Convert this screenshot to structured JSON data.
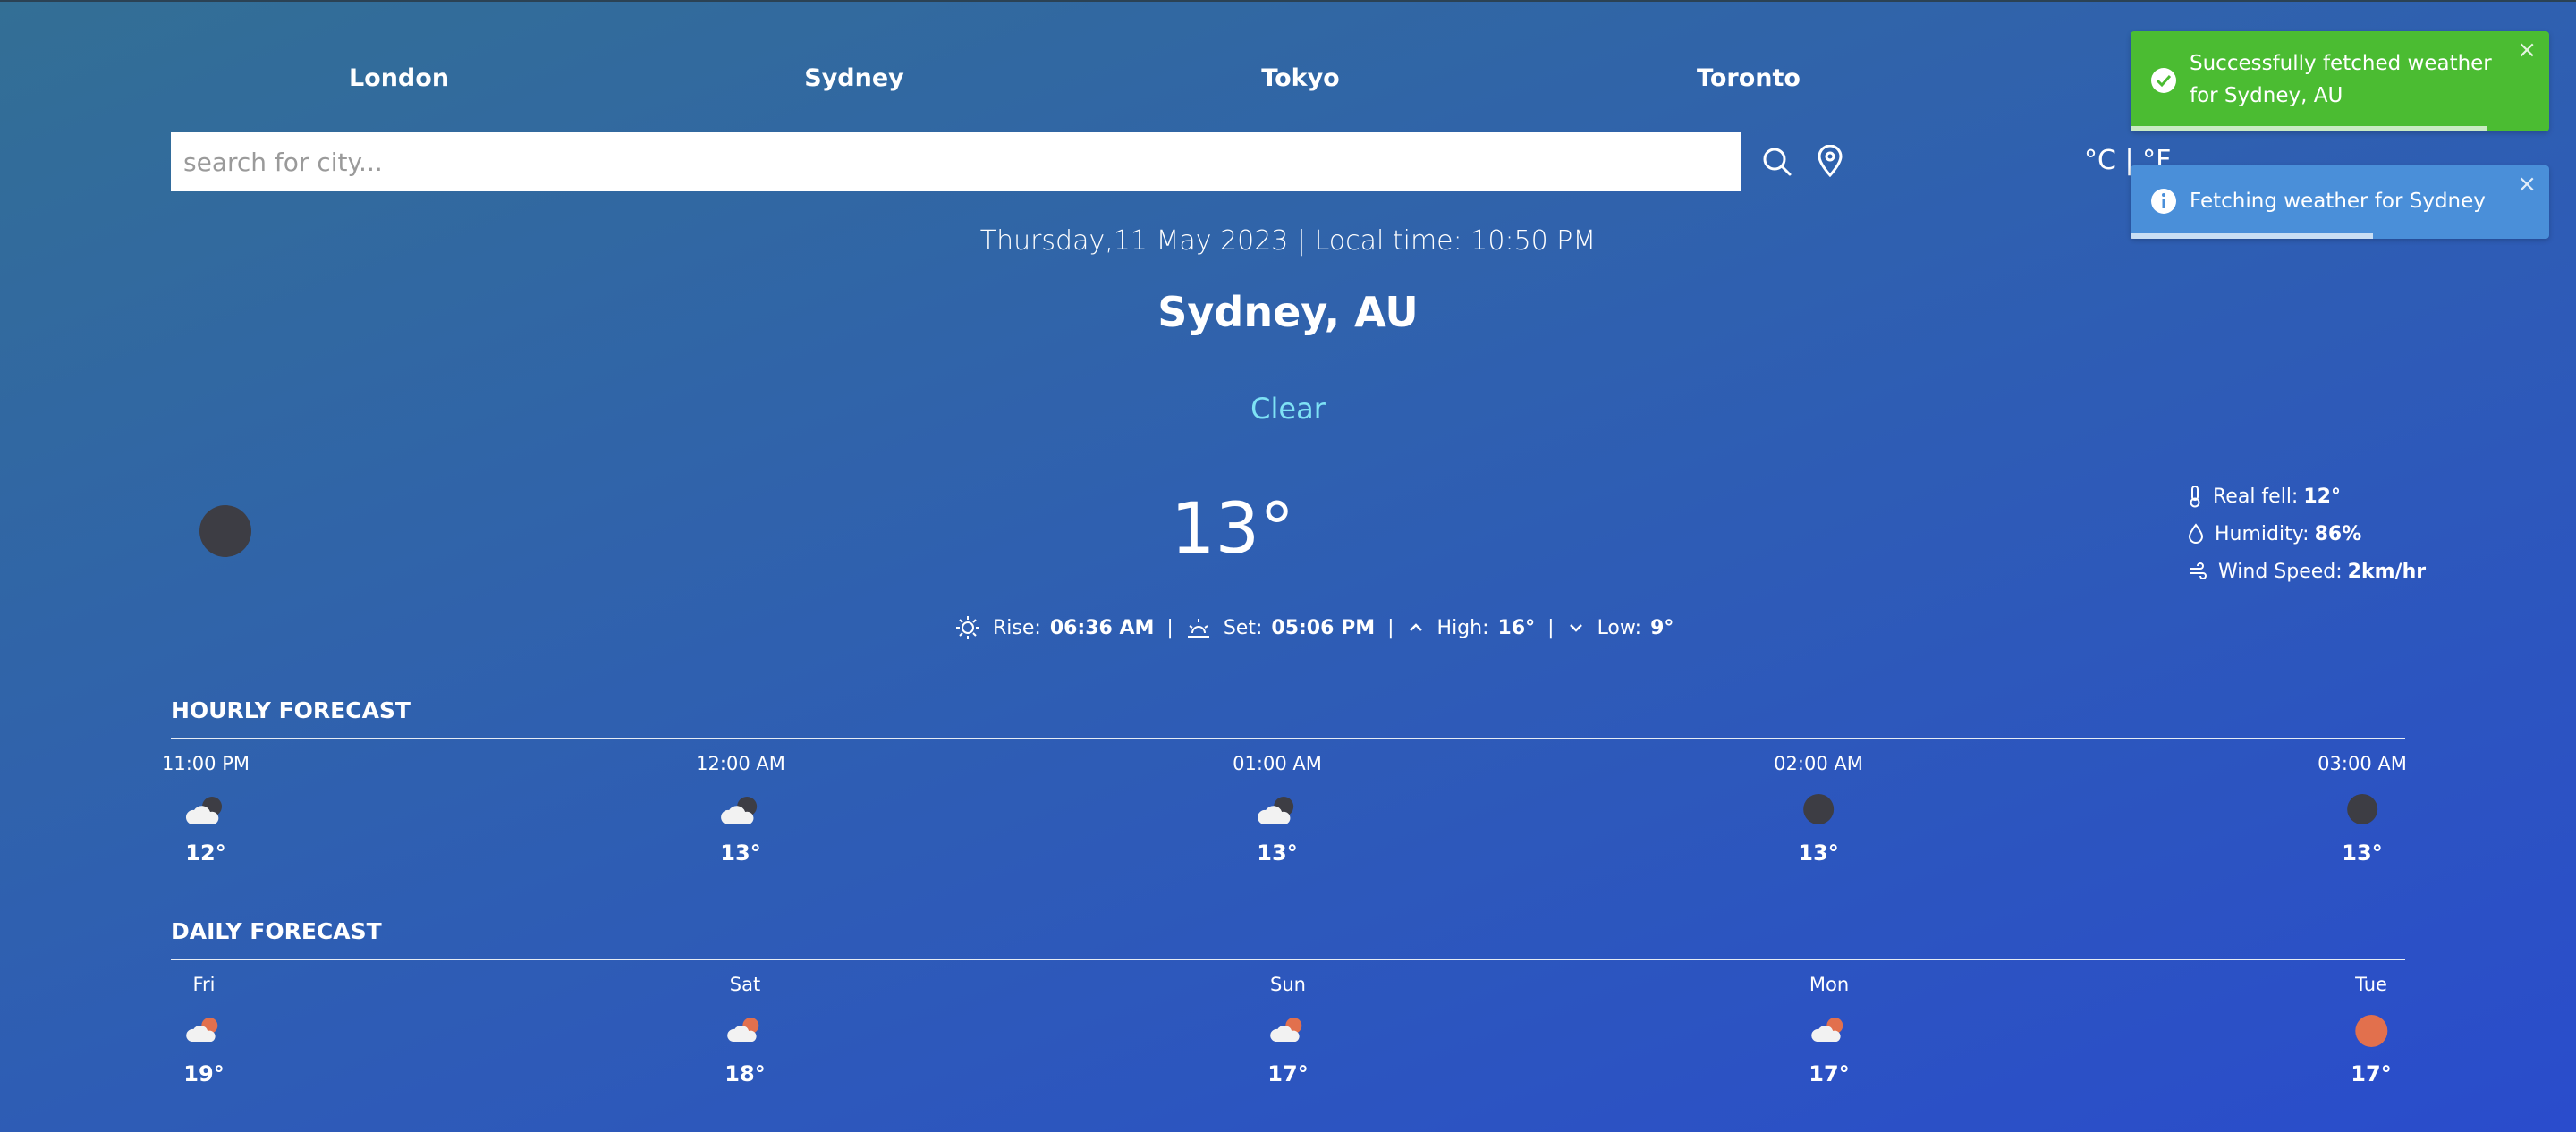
{
  "nav": {
    "cities": [
      "London",
      "Sydney",
      "Tokyo",
      "Toronto"
    ]
  },
  "search": {
    "placeholder": "search for city..."
  },
  "units": {
    "label": "°C | °F"
  },
  "current": {
    "date_line": "Thursday,11 May 2023 | Local time: 10:50 PM",
    "location": "Sydney, AU",
    "condition": "Clear",
    "temperature": "13°",
    "details": [
      {
        "label": "Real fell:",
        "value": "12°",
        "icon": "thermometer-icon"
      },
      {
        "label": "Humidity:",
        "value": "86%",
        "icon": "droplet-icon"
      },
      {
        "label": "Wind Speed:",
        "value": "2km/hr",
        "icon": "wind-icon"
      }
    ],
    "rise_label": "Rise:",
    "rise": "06:36 AM",
    "set_label": "Set:",
    "set": "05:06 PM",
    "high_label": "High:",
    "high": "16°",
    "low_label": "Low:",
    "low": "9°",
    "separator": "|"
  },
  "hourly": {
    "title": "HOURLY FORECAST",
    "items": [
      {
        "time": "11:00 PM",
        "temp": "12°",
        "icon": "cloudy-night-icon"
      },
      {
        "time": "12:00 AM",
        "temp": "13°",
        "icon": "cloudy-night-icon"
      },
      {
        "time": "01:00 AM",
        "temp": "13°",
        "icon": "cloudy-night-icon"
      },
      {
        "time": "02:00 AM",
        "temp": "13°",
        "icon": "clear-night-icon"
      },
      {
        "time": "03:00 AM",
        "temp": "13°",
        "icon": "clear-night-icon"
      }
    ]
  },
  "daily": {
    "title": "DAILY FORECAST",
    "items": [
      {
        "day": "Fri",
        "temp": "19°",
        "icon": "partly-cloudy-icon"
      },
      {
        "day": "Sat",
        "temp": "18°",
        "icon": "partly-cloudy-icon"
      },
      {
        "day": "Sun",
        "temp": "17°",
        "icon": "partly-cloudy-icon"
      },
      {
        "day": "Mon",
        "temp": "17°",
        "icon": "partly-cloudy-icon"
      },
      {
        "day": "Tue",
        "temp": "17°",
        "icon": "sun-icon"
      }
    ]
  },
  "toasts": [
    {
      "type": "success",
      "message": "Successfully fetched weather for Sydney, AU",
      "close": "×",
      "progress": 0.85
    },
    {
      "type": "info",
      "message": "Fetching weather for Sydney",
      "close": "×",
      "progress": 0.58
    }
  ],
  "colors": {
    "condition": "#7ee2f5",
    "success": "#4bbc32",
    "info": "#4a8fd9",
    "sun": "#e2704d"
  }
}
